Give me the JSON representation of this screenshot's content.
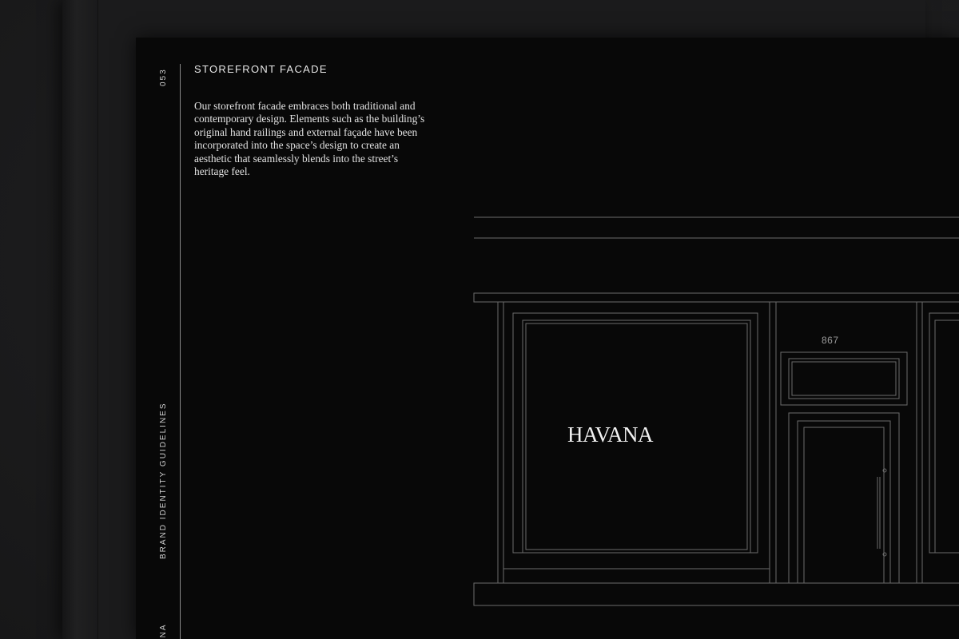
{
  "document": {
    "page_number": "053",
    "section_title": "STOREFRONT FACADE",
    "body_text": "Our storefront facade embraces both traditional and contemporary design. Elements such as the building’s original hand railings and external façade have been incorporated into the space’s design to create an aesthetic that seamlessly blends into the street’s heritage feel.",
    "running_header": "BRAND IDENTITY GUIDELINES",
    "brand_short": "ANA"
  },
  "facade": {
    "sign_text": "HAVANA",
    "street_number": "867"
  },
  "colors": {
    "page_background": "#080808",
    "line_color": "#6b6b6b",
    "text_color": "#e2e2e2"
  }
}
